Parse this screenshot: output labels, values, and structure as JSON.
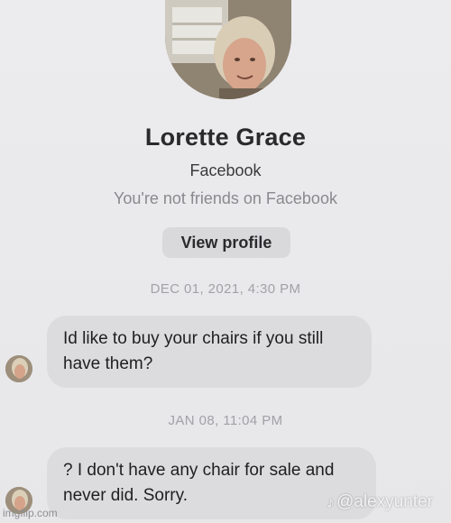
{
  "profile": {
    "name": "Lorette Grace",
    "platform": "Facebook",
    "friend_status": "You're not friends on Facebook",
    "view_profile_label": "View profile"
  },
  "messages": [
    {
      "timestamp": "DEC 01, 2021, 4:30 PM",
      "text": "Id like to buy your chairs if you still have them?"
    },
    {
      "timestamp": "JAN 08, 11:04 PM",
      "text": "? I don't have any chair for sale and never did. Sorry."
    }
  ],
  "watermarks": {
    "left": "imgflip.com",
    "right": "@alexyunter",
    "right_icon": "tiktok-icon"
  },
  "colors": {
    "background": "#e9e9eb",
    "bubble": "#dcdcde",
    "button": "#d9d9dc"
  }
}
